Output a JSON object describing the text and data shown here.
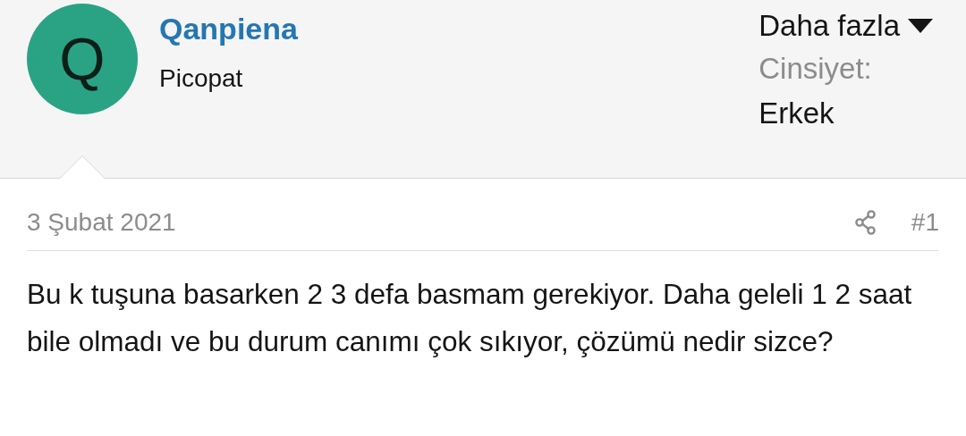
{
  "user": {
    "avatar_letter": "Q",
    "name": "Qanpiena",
    "title": "Picopat"
  },
  "more_menu": {
    "label": "Daha fazla"
  },
  "fields": [
    {
      "label": "Cinsiyet:",
      "value": "Erkek"
    }
  ],
  "post": {
    "date": "3 Şubat 2021",
    "number": "#1",
    "body": "Bu k tuşuna basarken 2 3 defa basmam gerekiyor. Daha geleli 1 2 saat bile olmadı ve bu durum canımı çok sıkıyor, çözümü nedir sizce?"
  }
}
